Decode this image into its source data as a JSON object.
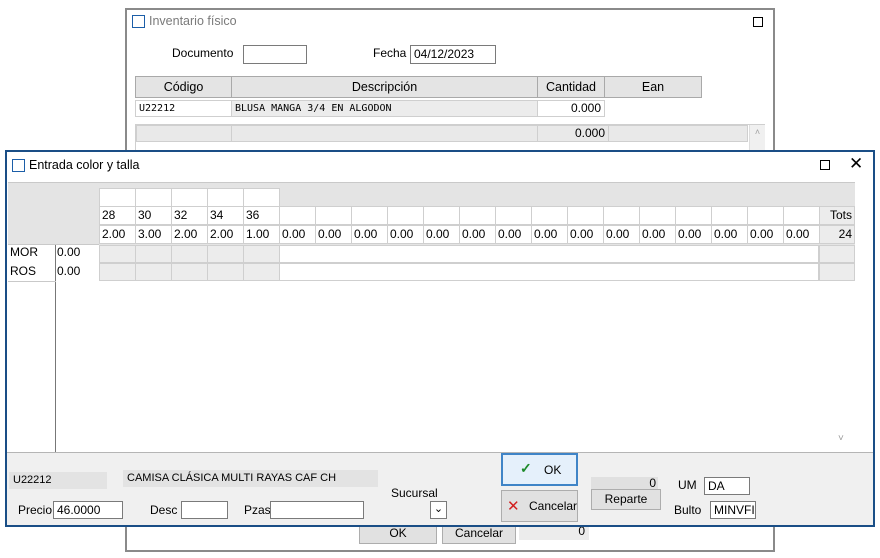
{
  "background_window": {
    "title": "Inventario físico",
    "documento_label": "Documento",
    "documento_value": "",
    "fecha_label": "Fecha",
    "fecha_value": "04/12/2023",
    "columns": [
      "Código",
      "Descripción",
      "Cantidad",
      "Ean"
    ],
    "row": {
      "codigo": "U22212",
      "descripcion": "BLUSA MANGA 3/4 EN ALGODON",
      "cantidad": "0.000"
    },
    "total": "0.000",
    "ok_label": "OK",
    "cancel_label": "Cancelar",
    "footer_value": "0"
  },
  "dialog": {
    "title": "Entrada color y talla",
    "sizes": [
      "28",
      "30",
      "32",
      "34",
      "36",
      "",
      "",
      "",
      "",
      "",
      "",
      "",
      "",
      "",
      "",
      "",
      "",
      "",
      "",
      "",
      ""
    ],
    "size_totals": [
      "2.00",
      "3.00",
      "2.00",
      "2.00",
      "1.00",
      "0.00",
      "0.00",
      "0.00",
      "0.00",
      "0.00",
      "0.00",
      "0.00",
      "0.00",
      "0.00",
      "0.00",
      "0.00",
      "0.00",
      "0.00",
      "0.00",
      "0.00"
    ],
    "tots_label": "Tots",
    "grand_total": "24",
    "rows": [
      {
        "color": "MOR",
        "value": "0.00"
      },
      {
        "color": "ROS",
        "value": "0.00"
      }
    ],
    "footer": {
      "code": "U22212",
      "description": "CAMISA CLÁSICA MULTI RAYAS CAF CH",
      "precio_label": "Precio",
      "precio_value": "46.0000",
      "desc_label": "Desc",
      "desc_value": "",
      "pzas_label": "Pzas",
      "pzas_value": "",
      "sucursal_label": "Sucursal",
      "ok_label": "OK",
      "cancel_label": "Cancelar",
      "counter_value": "0",
      "reparte_label": "Reparte",
      "um_label": "UM",
      "um_value": "DA",
      "bulto_label": "Bulto",
      "bulto_value": "MINVFIS"
    }
  },
  "colors": {
    "accent": "#1a4e86",
    "ok_check": "#1d8a2a",
    "cancel_x": "#d21f1f",
    "header_gray": "#e4e4e4"
  }
}
